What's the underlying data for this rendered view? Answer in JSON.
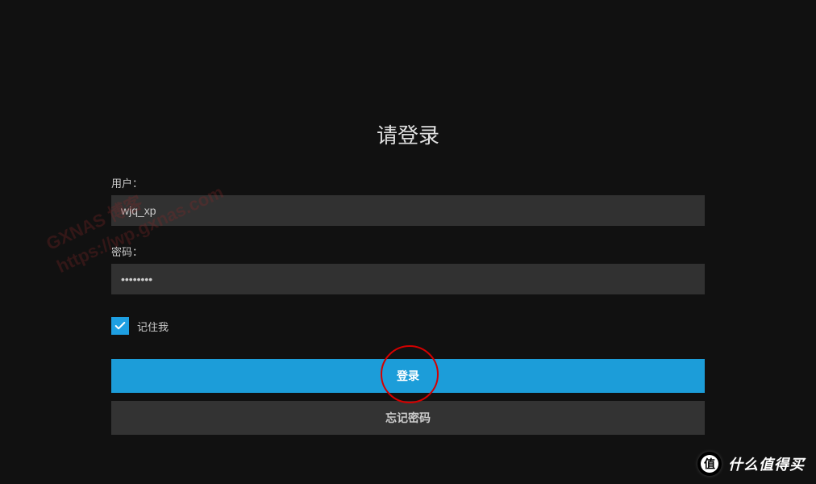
{
  "watermark": {
    "line1": "GXNAS 博客",
    "line2": "https://wp.gxnas.com"
  },
  "login": {
    "title": "请登录",
    "username_label": "用户：",
    "username_value": "wjq_xp",
    "password_label": "密码：",
    "password_value": "••••••••",
    "remember_label": "记住我",
    "login_button": "登录",
    "forgot_button": "忘记密码"
  },
  "promo": {
    "badge_char": "值",
    "text": "什么值得买"
  },
  "colors": {
    "accent": "#1c9dd9",
    "background": "#111111",
    "input_bg": "#313131",
    "annotation": "#d40000"
  }
}
